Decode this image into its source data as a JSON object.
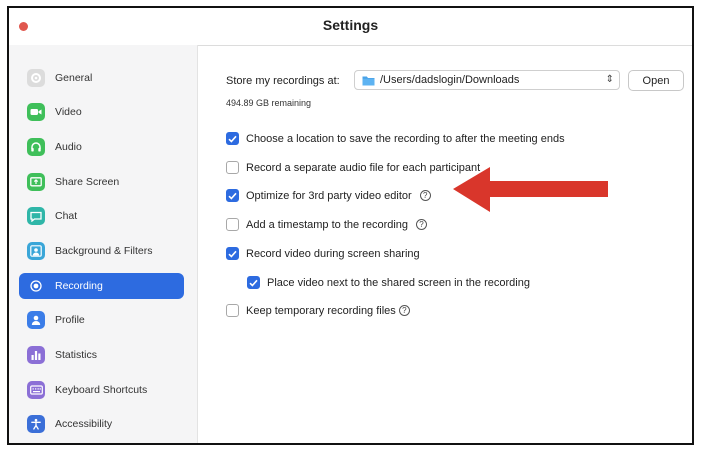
{
  "window": {
    "title": "Settings"
  },
  "colors": {
    "accent": "#2d6be0",
    "close": "#e0574e",
    "arrow": "#d9362b"
  },
  "sidebar": {
    "items": [
      {
        "label": "General",
        "icon": "gear-icon",
        "active": false
      },
      {
        "label": "Video",
        "icon": "video-camera-icon",
        "active": false
      },
      {
        "label": "Audio",
        "icon": "headphones-icon",
        "active": false
      },
      {
        "label": "Share Screen",
        "icon": "share-screen-icon",
        "active": false
      },
      {
        "label": "Chat",
        "icon": "chat-bubble-icon",
        "active": false
      },
      {
        "label": "Background & Filters",
        "icon": "person-background-icon",
        "active": false
      },
      {
        "label": "Recording",
        "icon": "record-icon",
        "active": true
      },
      {
        "label": "Profile",
        "icon": "profile-icon",
        "active": false
      },
      {
        "label": "Statistics",
        "icon": "bar-chart-icon",
        "active": false
      },
      {
        "label": "Keyboard Shortcuts",
        "icon": "keyboard-icon",
        "active": false
      },
      {
        "label": "Accessibility",
        "icon": "accessibility-icon",
        "active": false
      }
    ]
  },
  "recording": {
    "store_label": "Store my recordings at:",
    "path": "/Users/dadslogin/Downloads",
    "open_label": "Open",
    "remaining": "494.89 GB remaining",
    "options": [
      {
        "label": "Choose a location to save the recording to after the meeting ends",
        "checked": true,
        "help": false
      },
      {
        "label": "Record a separate audio file for each participant",
        "checked": false,
        "help": false
      },
      {
        "label": "Optimize for 3rd party video editor",
        "checked": true,
        "help": true
      },
      {
        "label": "Add a timestamp to the recording",
        "checked": false,
        "help": true
      },
      {
        "label": "Record video during screen sharing",
        "checked": true,
        "help": false
      },
      {
        "label": "Place video next to the shared screen in the recording",
        "checked": true,
        "help": false
      },
      {
        "label": "Keep temporary recording files",
        "checked": false,
        "help": true
      }
    ],
    "help_glyph": "?"
  }
}
